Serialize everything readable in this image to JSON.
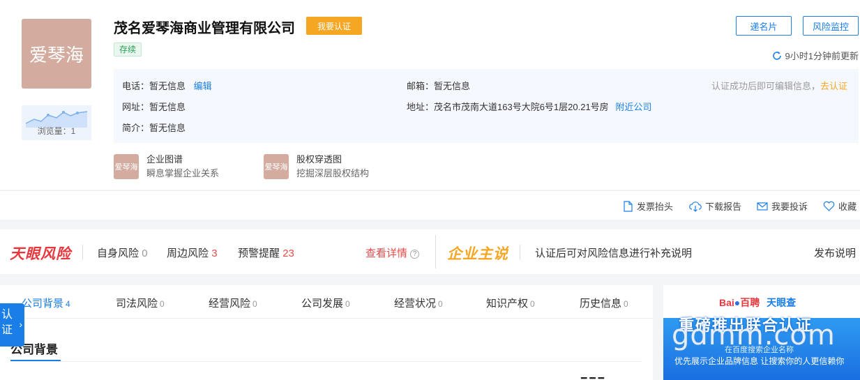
{
  "company": {
    "logo_text": "爱琴海",
    "name": "茂名爱琴海商业管理有限公司",
    "cert_button": "我要认证",
    "status": "存续",
    "views_label": "浏览量：1"
  },
  "header_buttons": {
    "card": "递名片",
    "monitor": "风险监控",
    "updated": "9小时1分钟前更新"
  },
  "info": {
    "phone_label": "电话：暂无信息",
    "phone_edit": "编辑",
    "email_label": "邮箱：暂无信息",
    "cert_hint": "认证成功后即可编辑信息，",
    "cert_link": "去认证",
    "website_label": "网址：暂无信息",
    "address_label": "地址：茂名市茂南大道163号大院6号1层20.21号房",
    "nearby_link": "附近公司",
    "intro_label": "简介：暂无信息"
  },
  "features": [
    {
      "icon_text": "爱琴海",
      "title": "企业图谱",
      "sub": "瞬息掌握企业关系"
    },
    {
      "icon_text": "爱琴海",
      "title": "股权穿透图",
      "sub": "挖掘深层股权结构"
    }
  ],
  "actions": {
    "invoice": "发票抬头",
    "download": "下载报告",
    "complain": "我要投诉",
    "favorite": "收藏"
  },
  "risk": {
    "logo": "天眼风险",
    "self_label": "自身风险",
    "self_count": "0",
    "around_label": "周边风险",
    "around_count": "3",
    "warn_label": "预警提醒",
    "warn_count": "23",
    "detail_link": "查看详情",
    "owner_logo": "企业主说",
    "owner_text": "认证后可对风险信息进行补充说明",
    "publish_link": "发布说明"
  },
  "tabs": [
    {
      "label": "公司背景",
      "count": "4"
    },
    {
      "label": "司法风险",
      "count": "0"
    },
    {
      "label": "经营风险",
      "count": "0"
    },
    {
      "label": "公司发展",
      "count": "0"
    },
    {
      "label": "经营状况",
      "count": "0"
    },
    {
      "label": "知识产权",
      "count": "0"
    },
    {
      "label": "历史信息",
      "count": "0"
    }
  ],
  "section": {
    "title": "公司背景"
  },
  "sidetab": {
    "text": "认证"
  },
  "ad": {
    "brand1": "Bai",
    "brand2": "百聘",
    "brand3": "天眼查",
    "headline": "重磅推出联合认证",
    "sub1": "在百度搜索企业名称",
    "sub2": "优先展示企业品牌信息 让搜索你的人更信赖你"
  },
  "watermark": "gdmm.com",
  "colors": {
    "primary": "#1a7ee8",
    "orange": "#f5a623",
    "red": "#e94a4a",
    "logo_bg": "#d3ab9f"
  }
}
